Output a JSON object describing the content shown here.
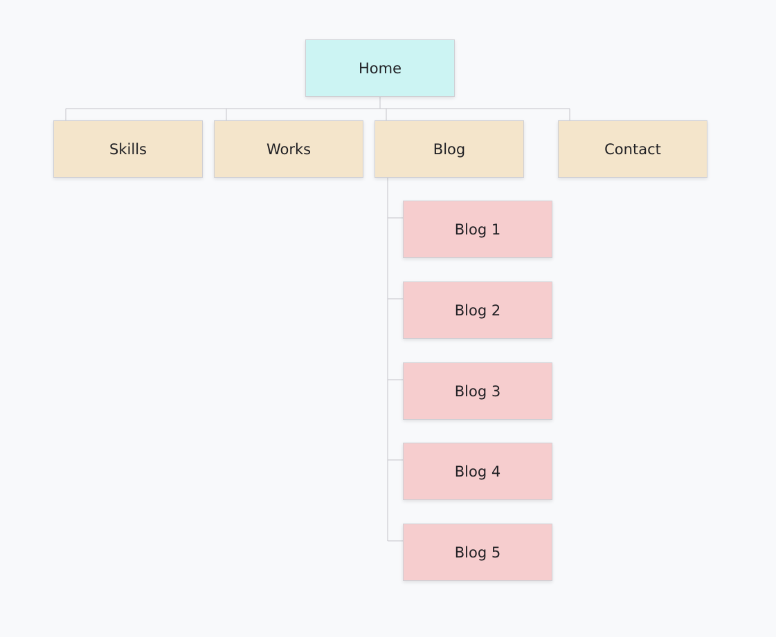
{
  "colors": {
    "background": "#f8f9fb",
    "root": "#ccf4f3",
    "level1": "#f4e5cb",
    "level2": "#f6cdce",
    "connector": "#c3c4c9",
    "text": "#1f1f23"
  },
  "sitemap": {
    "root": {
      "label": "Home"
    },
    "sections": [
      {
        "label": "Skills"
      },
      {
        "label": "Works"
      },
      {
        "label": "Blog"
      },
      {
        "label": "Contact"
      }
    ],
    "blog_children": [
      {
        "label": "Blog 1"
      },
      {
        "label": "Blog 2"
      },
      {
        "label": "Blog 3"
      },
      {
        "label": "Blog 4"
      },
      {
        "label": "Blog 5"
      }
    ]
  }
}
